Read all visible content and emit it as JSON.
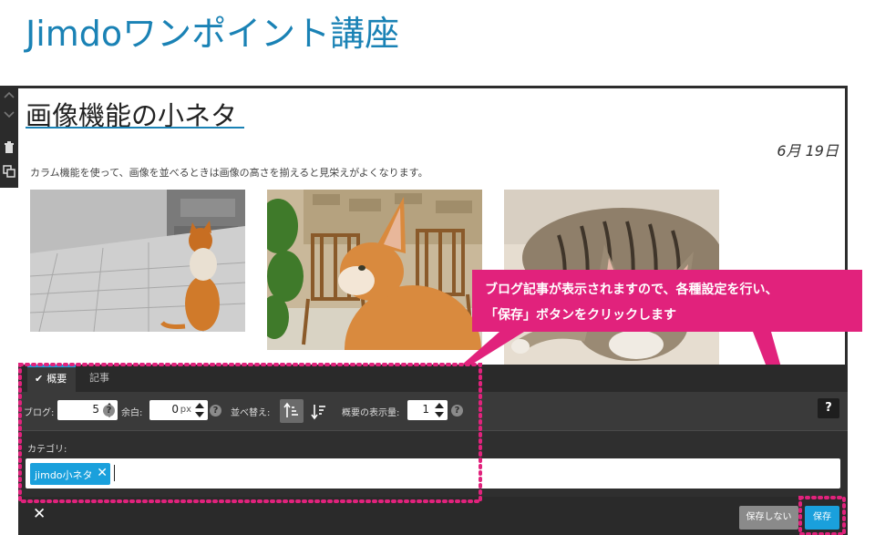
{
  "header": {
    "site_title": "Jimdoワンポイント講座"
  },
  "post": {
    "title": "画像機能の小ネタ",
    "date": "6月 19日",
    "description": "カラム機能を使って、画像を並べるときは画像の高さを揃えると見栄えがよくなります。"
  },
  "callout": {
    "line1": "ブログ記事が表示されますので、各種設定を行い、",
    "line2": "「保存」ボタンをクリックします"
  },
  "panel": {
    "tabs": [
      {
        "label": "概要",
        "active": true
      },
      {
        "label": "記事",
        "active": false
      }
    ],
    "settings": {
      "blog_label": "ブログ:",
      "blog_value": "5",
      "margin_label": "余白:",
      "margin_value": "0",
      "margin_unit": "px",
      "sort_label": "並べ替え:",
      "summary_label": "概要の表示量:",
      "summary_value": "1",
      "help_glyph": "?"
    },
    "category": {
      "label": "カテゴリ:",
      "tag": "jimdo小ネタ"
    },
    "footer": {
      "discard_label": "保存しない",
      "save_label": "保存"
    }
  },
  "colors": {
    "brand_blue": "#1a82b5",
    "accent_blue": "#1aa0dc",
    "annotation_pink": "#e1227c",
    "panel_dark": "#2f2f2f"
  },
  "icons": [
    "chevron-up-icon",
    "chevron-down-icon",
    "trash-icon",
    "copy-icon",
    "check-icon",
    "help-icon",
    "sort-ascending-icon",
    "sort-descending-icon",
    "close-icon"
  ]
}
